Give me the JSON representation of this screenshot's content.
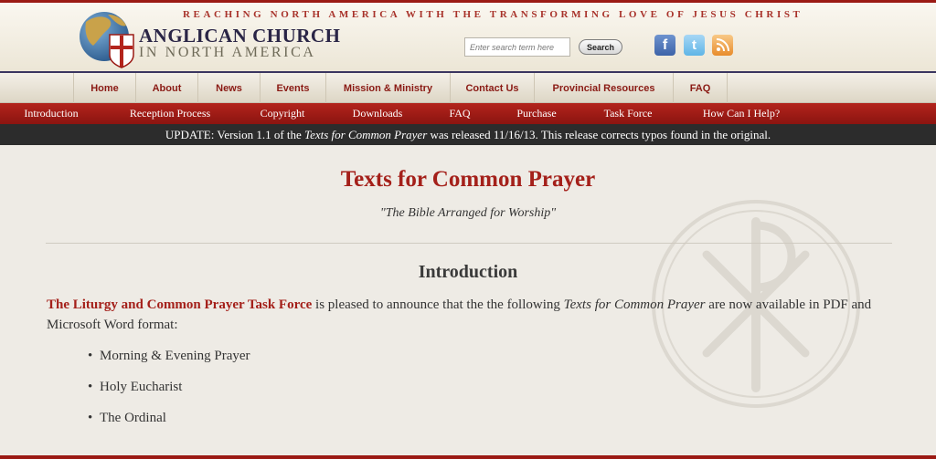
{
  "header": {
    "tagline": "REACHING NORTH AMERICA WITH THE TRANSFORMING LOVE OF JESUS CHRIST",
    "logo_line1": "ANGLICAN CHURCH",
    "logo_line2": "IN NORTH AMERICA",
    "search_placeholder": "Enter search term here",
    "search_button": "Search",
    "social": {
      "facebook": "f",
      "twitter": "t",
      "rss": ")"
    }
  },
  "main_nav": [
    "Home",
    "About",
    "News",
    "Events",
    "Mission & Ministry",
    "Contact Us",
    "Provincial Resources",
    "FAQ"
  ],
  "sub_nav": [
    "Introduction",
    "Reception Process",
    "Copyright",
    "Downloads",
    "FAQ",
    "Purchase",
    "Task Force",
    "How Can I Help?"
  ],
  "update": {
    "prefix": "UPDATE: Version 1.1 of the ",
    "italic": "Texts for Common Prayer",
    "suffix": " was released 11/16/13. This release corrects typos found in the original."
  },
  "content": {
    "title": "Texts for Common Prayer",
    "subtitle": "\"The Bible Arranged for Worship\"",
    "section_title": "Introduction",
    "intro_link": "The Liturgy and Common Prayer Task Force",
    "intro_middle": " is pleased to announce that the the following ",
    "intro_italic": "Texts for Common Prayer",
    "intro_end": " are now available in PDF and Microsoft Word format:",
    "items": [
      "Morning & Evening Prayer",
      "Holy Eucharist",
      "The Ordinal"
    ]
  },
  "colors": {
    "brand_red": "#a4201a",
    "navy": "#2a2546",
    "update_bar": "#2c2c2c"
  }
}
